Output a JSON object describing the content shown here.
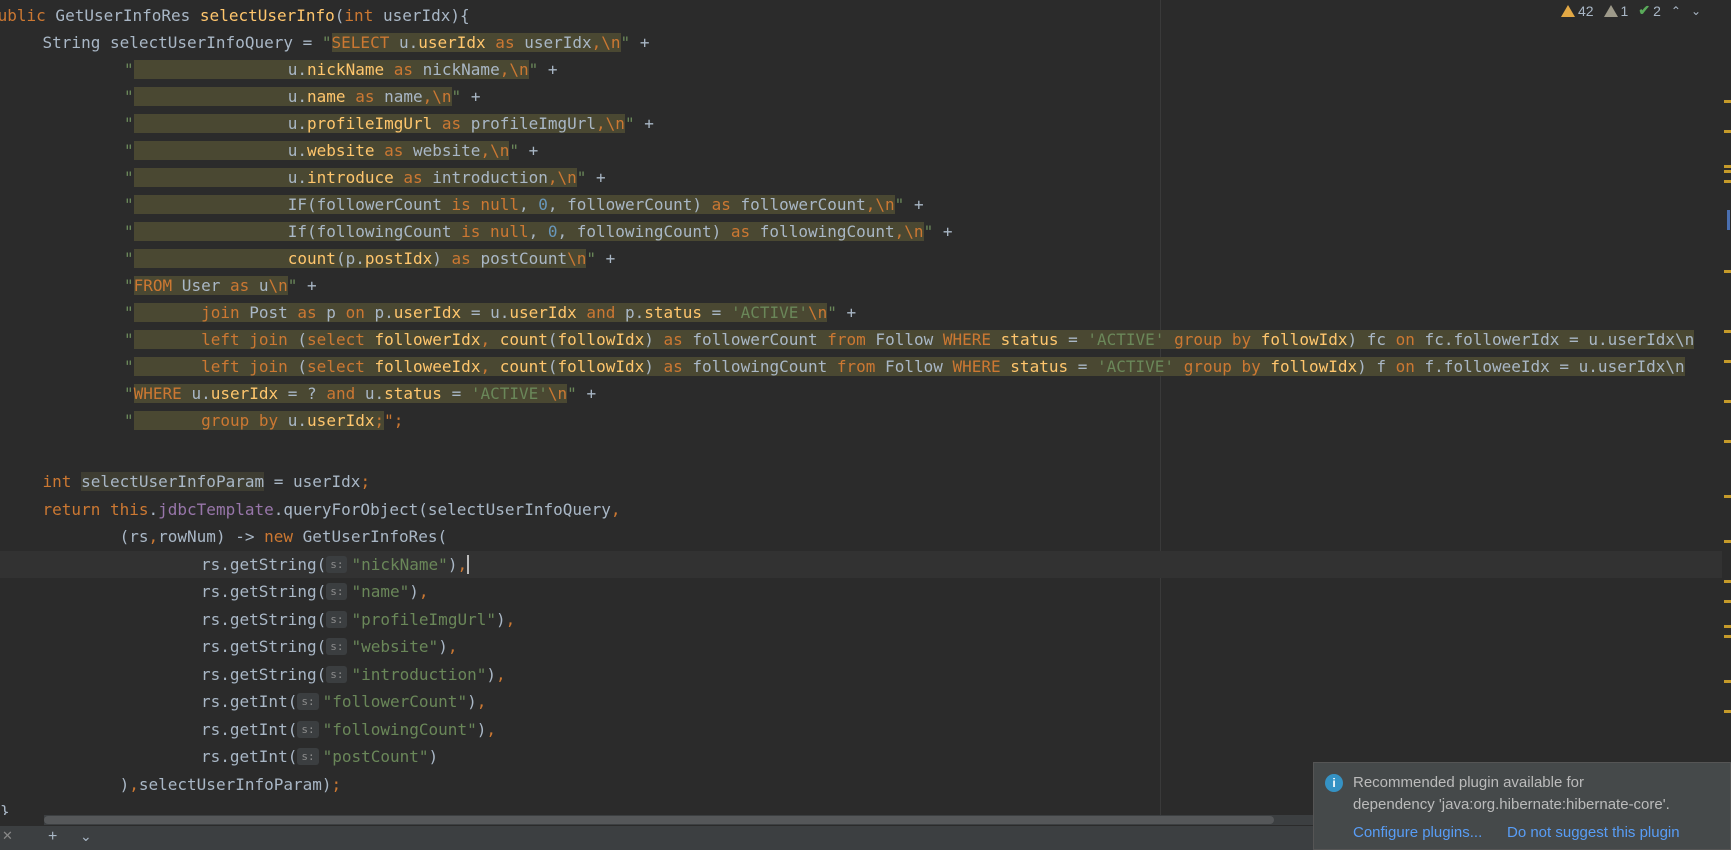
{
  "inspection": {
    "warnings": "42",
    "weak_warnings": "1",
    "typos": "2"
  },
  "notification": {
    "message_line1": "Recommended plugin available for",
    "message_line2": "dependency 'java:org.hibernate:hibernate-core'.",
    "configure_link": "Configure plugins...",
    "dismiss_link": "Do not suggest this plugin"
  },
  "param_hint": "s:",
  "code": {
    "l1": {
      "a": "public",
      "b": " GetUserInfoRes ",
      "c": "selectUserInfo",
      "d": "(",
      "e": "int",
      "f": " userIdx){"
    },
    "l2": {
      "a": "    String selectUserInfoQuery = ",
      "b": "\"",
      "c": "SELECT",
      "d": " u.",
      "e": "userIdx",
      "f": " as",
      "g": " userIdx",
      "h": ",",
      "i": "\\n",
      "j": "\"",
      "k": " +"
    },
    "l3": {
      "a": "\"",
      "b": "                u.",
      "c": "nickName",
      "d": " as",
      "e": " nickName",
      "f": ",",
      "g": "\\n",
      "h": "\"",
      "i": " +"
    },
    "l4": {
      "a": "\"",
      "b": "                u.",
      "c": "name",
      "d": " as",
      "e": " name",
      "f": ",",
      "g": "\\n",
      "h": "\"",
      "i": " +"
    },
    "l5": {
      "a": "\"",
      "b": "                u.",
      "c": "profileImgUrl",
      "d": " as",
      "e": " profileImgUrl",
      "f": ",",
      "g": "\\n",
      "h": "\"",
      "i": " +"
    },
    "l6": {
      "a": "\"",
      "b": "                u.",
      "c": "website",
      "d": " as",
      "e": " website",
      "f": ",",
      "g": "\\n",
      "h": "\"",
      "i": " +"
    },
    "l7": {
      "a": "\"",
      "b": "                u.",
      "c": "introduce",
      "d": " as",
      "e": " introduction",
      "f": ",",
      "g": "\\n",
      "h": "\"",
      "i": " +"
    },
    "l8": {
      "a": "\"",
      "b": "                IF(followerCount ",
      "c": "is null",
      "d": ", ",
      "e": "0",
      "f": ", followerCount) ",
      "g": "as",
      "h": " followerCount",
      "i": ",",
      "j": "\\n",
      "k": "\"",
      "l": " +"
    },
    "l9": {
      "a": "\"",
      "b": "                If(followingCount ",
      "c": "is null",
      "d": ", ",
      "e": "0",
      "f": ", followingCount) ",
      "g": "as",
      "h": " followingCount",
      "i": ",",
      "j": "\\n",
      "k": "\"",
      "l": " +"
    },
    "l10": {
      "a": "\"",
      "b": "                ",
      "c": "count",
      "d": "(p.",
      "e": "postIdx",
      "f": ") ",
      "g": "as",
      "h": " postCount",
      "i": "\\n",
      "j": "\"",
      "k": " +"
    },
    "l11": {
      "a": "\"",
      "b": "FROM",
      "c": " User ",
      "d": "as",
      "e": " u",
      "f": "\\n",
      "g": "\"",
      "h": " +"
    },
    "l12": {
      "a": "\"",
      "b": "       ",
      "c": "join",
      "d": " Post ",
      "e": "as",
      "f": " p ",
      "g": "on",
      "h": " p.",
      "i": "userIdx",
      "j": " = u.",
      "k": "userIdx",
      "l": " and",
      "m": " p.",
      "n": "status",
      "o": " = ",
      "p": "'ACTIVE'",
      "q": "\\n",
      "r": "\"",
      "s": " +"
    },
    "l13": {
      "a": "\"",
      "b": "       ",
      "c": "left join",
      "d": " (",
      "e": "select",
      "f": " ",
      "g": "followerIdx",
      "h": ", ",
      "i": "count",
      "j": "(",
      "k": "followIdx",
      "l": ") ",
      "m": "as",
      "n": " followerCount ",
      "o": "from",
      "p": " Follow ",
      "q": "WHERE",
      "r": " ",
      "s": "status",
      "t": " = ",
      "u": "'ACTIVE'",
      "v": " ",
      "w": "group by",
      "x": " ",
      "y": "followIdx",
      "z": ") fc ",
      "aa": "on",
      "ab": " fc.followerIdx = u.userIdx\\n"
    },
    "l14": {
      "a": "\"",
      "b": "       ",
      "c": "left join",
      "d": " (",
      "e": "select",
      "f": " ",
      "g": "followeeIdx",
      "h": ", ",
      "i": "count",
      "j": "(",
      "k": "followIdx",
      "l": ") ",
      "m": "as",
      "n": " followingCount ",
      "o": "from",
      "p": " Follow ",
      "q": "WHERE",
      "r": " ",
      "s": "status",
      "t": " = ",
      "u": "'ACTIVE'",
      "v": " ",
      "w": "group by",
      "x": " ",
      "y": "followIdx",
      "z": ") f ",
      "aa": "on",
      "ab": " f.followeeIdx = u.userIdx\\n"
    },
    "l15": {
      "a": "\"",
      "b": "WHERE",
      "c": " u.",
      "d": "userIdx",
      "e": " = ? ",
      "f": "and",
      "g": " u.",
      "h": "status",
      "i": " = ",
      "j": "'ACTIVE'",
      "k": "\\n",
      "l": "\"",
      "m": " +"
    },
    "l16": {
      "a": "\"",
      "b": "       ",
      "c": "group by",
      "d": " u.",
      "e": "userIdx",
      "f": ";",
      "g": "\";"
    },
    "l17": {
      "a": "    ",
      "b": "int",
      "c": " ",
      "d": "selectUserInfoParam",
      "e": " = userIdx",
      "f": ";"
    },
    "l18": {
      "a": "    ",
      "b": "return this",
      "c": ".",
      "d": "jdbcTemplate",
      "e": ".queryForObject(selectUserInfoQuery",
      "f": ","
    },
    "l19": {
      "a": "            (rs",
      "b": ",",
      "c": "rowNum) -> ",
      "d": "new",
      "e": " GetUserInfoRes("
    },
    "l20": {
      "a": "rs.getString(",
      "b": "\"nickName\"",
      "c": ")",
      "d": ","
    },
    "l21": {
      "a": "rs.getString(",
      "b": "\"name\"",
      "c": ")",
      "d": ","
    },
    "l22": {
      "a": "rs.getString(",
      "b": "\"profileImgUrl\"",
      "c": ")",
      "d": ","
    },
    "l23": {
      "a": "rs.getString(",
      "b": "\"website\"",
      "c": ")",
      "d": ","
    },
    "l24": {
      "a": "rs.getString(",
      "b": "\"introduction\"",
      "c": ")",
      "d": ","
    },
    "l25": {
      "a": "rs.getInt(",
      "b": "\"followerCount\"",
      "c": ")",
      "d": ","
    },
    "l26": {
      "a": "rs.getInt(",
      "b": "\"followingCount\"",
      "c": ")",
      "d": ","
    },
    "l27": {
      "a": "rs.getInt(",
      "b": "\"postCount\"",
      "c": ")"
    },
    "l28": {
      "a": "            )",
      "b": ",",
      "c": "selectUserInfoParam)",
      "d": ";"
    },
    "l29": {
      "a": "}"
    }
  }
}
